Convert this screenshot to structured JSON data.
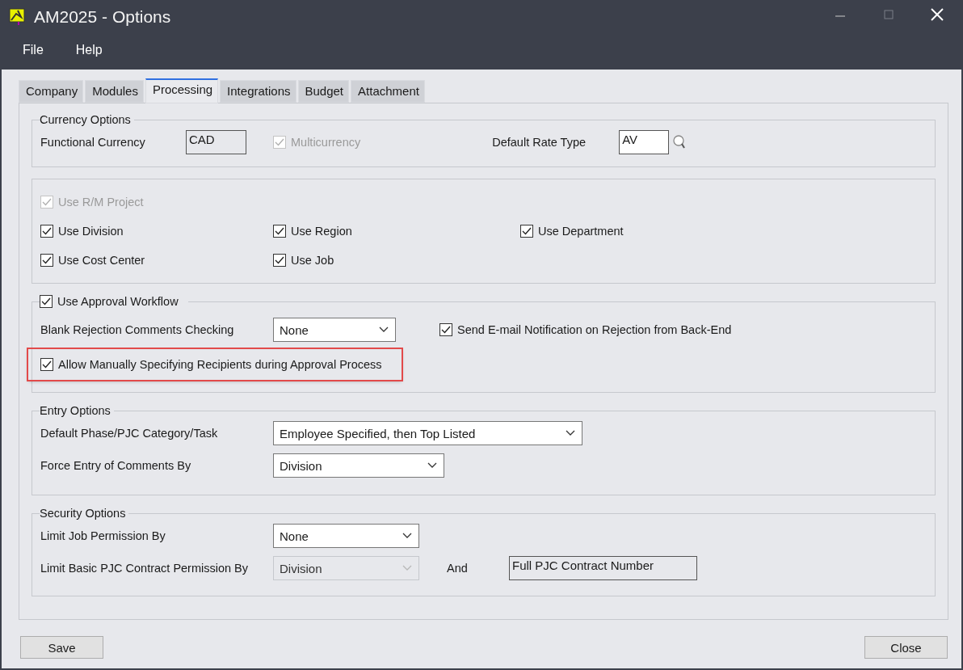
{
  "window": {
    "title": "AM2025 - Options"
  },
  "menu": [
    {
      "label": "File"
    },
    {
      "label": "Help"
    }
  ],
  "tabs": [
    {
      "label": "Company",
      "selected": false
    },
    {
      "label": "Modules",
      "selected": false
    },
    {
      "label": "Processing",
      "selected": true
    },
    {
      "label": "Integrations",
      "selected": false
    },
    {
      "label": "Budget",
      "selected": false
    },
    {
      "label": "Attachment",
      "selected": false
    }
  ],
  "currency": {
    "legend": "Currency Options",
    "functional_label": "Functional Currency",
    "functional_value": "CAD",
    "multicurrency": {
      "label": "Multicurrency",
      "checked": true,
      "disabled": true
    },
    "rate_label": "Default Rate Type",
    "rate_value": "AV"
  },
  "dimensions": {
    "use_rm_project": {
      "label": "Use R/M Project",
      "checked": true,
      "disabled": true
    },
    "options": [
      {
        "label": "Use Division",
        "checked": true
      },
      {
        "label": "Use Region",
        "checked": true
      },
      {
        "label": "Use Department",
        "checked": true
      },
      {
        "label": "Use Cost Center",
        "checked": true
      },
      {
        "label": "Use Job",
        "checked": true
      }
    ]
  },
  "approval": {
    "workflow": {
      "label": "Use Approval Workflow",
      "checked": true
    },
    "blank_label": "Blank Rejection Comments Checking",
    "blank_value": "None",
    "email": {
      "label": "Send E-mail Notification on Rejection from Back-End",
      "checked": true
    },
    "allow": {
      "label": "Allow Manually Specifying Recipients during Approval Process",
      "checked": true,
      "highlighted": true
    }
  },
  "entry": {
    "legend": "Entry Options",
    "fields": [
      {
        "label": "Default Phase/PJC Category/Task",
        "value": "Employee Specified, then Top Listed"
      },
      {
        "label": "Force Entry of Comments By",
        "value": "Division"
      }
    ]
  },
  "security": {
    "legend": "Security Options",
    "job_label": "Limit Job Permission By",
    "job_value": "None",
    "contract_label": "Limit Basic PJC Contract Permission By",
    "contract_value": "Division",
    "contract_disabled": true,
    "and_label": "And",
    "contract_number": "Full PJC Contract Number"
  },
  "buttons": {
    "save": "Save",
    "close": "Close"
  }
}
